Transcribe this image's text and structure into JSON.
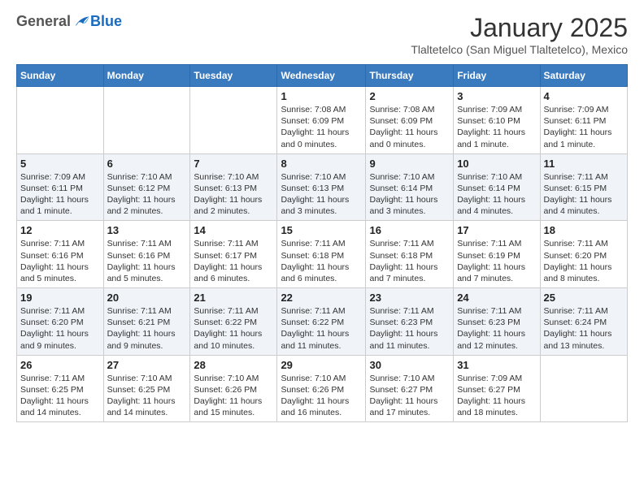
{
  "header": {
    "logo_general": "General",
    "logo_blue": "Blue",
    "month_year": "January 2025",
    "location": "Tlaltetelco (San Miguel Tlaltetelco), Mexico"
  },
  "weekdays": [
    "Sunday",
    "Monday",
    "Tuesday",
    "Wednesday",
    "Thursday",
    "Friday",
    "Saturday"
  ],
  "weeks": [
    [
      {
        "day": "",
        "info": ""
      },
      {
        "day": "",
        "info": ""
      },
      {
        "day": "",
        "info": ""
      },
      {
        "day": "1",
        "info": "Sunrise: 7:08 AM\nSunset: 6:09 PM\nDaylight: 11 hours\nand 0 minutes."
      },
      {
        "day": "2",
        "info": "Sunrise: 7:08 AM\nSunset: 6:09 PM\nDaylight: 11 hours\nand 0 minutes."
      },
      {
        "day": "3",
        "info": "Sunrise: 7:09 AM\nSunset: 6:10 PM\nDaylight: 11 hours\nand 1 minute."
      },
      {
        "day": "4",
        "info": "Sunrise: 7:09 AM\nSunset: 6:11 PM\nDaylight: 11 hours\nand 1 minute."
      }
    ],
    [
      {
        "day": "5",
        "info": "Sunrise: 7:09 AM\nSunset: 6:11 PM\nDaylight: 11 hours\nand 1 minute."
      },
      {
        "day": "6",
        "info": "Sunrise: 7:10 AM\nSunset: 6:12 PM\nDaylight: 11 hours\nand 2 minutes."
      },
      {
        "day": "7",
        "info": "Sunrise: 7:10 AM\nSunset: 6:13 PM\nDaylight: 11 hours\nand 2 minutes."
      },
      {
        "day": "8",
        "info": "Sunrise: 7:10 AM\nSunset: 6:13 PM\nDaylight: 11 hours\nand 3 minutes."
      },
      {
        "day": "9",
        "info": "Sunrise: 7:10 AM\nSunset: 6:14 PM\nDaylight: 11 hours\nand 3 minutes."
      },
      {
        "day": "10",
        "info": "Sunrise: 7:10 AM\nSunset: 6:14 PM\nDaylight: 11 hours\nand 4 minutes."
      },
      {
        "day": "11",
        "info": "Sunrise: 7:11 AM\nSunset: 6:15 PM\nDaylight: 11 hours\nand 4 minutes."
      }
    ],
    [
      {
        "day": "12",
        "info": "Sunrise: 7:11 AM\nSunset: 6:16 PM\nDaylight: 11 hours\nand 5 minutes."
      },
      {
        "day": "13",
        "info": "Sunrise: 7:11 AM\nSunset: 6:16 PM\nDaylight: 11 hours\nand 5 minutes."
      },
      {
        "day": "14",
        "info": "Sunrise: 7:11 AM\nSunset: 6:17 PM\nDaylight: 11 hours\nand 6 minutes."
      },
      {
        "day": "15",
        "info": "Sunrise: 7:11 AM\nSunset: 6:18 PM\nDaylight: 11 hours\nand 6 minutes."
      },
      {
        "day": "16",
        "info": "Sunrise: 7:11 AM\nSunset: 6:18 PM\nDaylight: 11 hours\nand 7 minutes."
      },
      {
        "day": "17",
        "info": "Sunrise: 7:11 AM\nSunset: 6:19 PM\nDaylight: 11 hours\nand 7 minutes."
      },
      {
        "day": "18",
        "info": "Sunrise: 7:11 AM\nSunset: 6:20 PM\nDaylight: 11 hours\nand 8 minutes."
      }
    ],
    [
      {
        "day": "19",
        "info": "Sunrise: 7:11 AM\nSunset: 6:20 PM\nDaylight: 11 hours\nand 9 minutes."
      },
      {
        "day": "20",
        "info": "Sunrise: 7:11 AM\nSunset: 6:21 PM\nDaylight: 11 hours\nand 9 minutes."
      },
      {
        "day": "21",
        "info": "Sunrise: 7:11 AM\nSunset: 6:22 PM\nDaylight: 11 hours\nand 10 minutes."
      },
      {
        "day": "22",
        "info": "Sunrise: 7:11 AM\nSunset: 6:22 PM\nDaylight: 11 hours\nand 11 minutes."
      },
      {
        "day": "23",
        "info": "Sunrise: 7:11 AM\nSunset: 6:23 PM\nDaylight: 11 hours\nand 11 minutes."
      },
      {
        "day": "24",
        "info": "Sunrise: 7:11 AM\nSunset: 6:23 PM\nDaylight: 11 hours\nand 12 minutes."
      },
      {
        "day": "25",
        "info": "Sunrise: 7:11 AM\nSunset: 6:24 PM\nDaylight: 11 hours\nand 13 minutes."
      }
    ],
    [
      {
        "day": "26",
        "info": "Sunrise: 7:11 AM\nSunset: 6:25 PM\nDaylight: 11 hours\nand 14 minutes."
      },
      {
        "day": "27",
        "info": "Sunrise: 7:10 AM\nSunset: 6:25 PM\nDaylight: 11 hours\nand 14 minutes."
      },
      {
        "day": "28",
        "info": "Sunrise: 7:10 AM\nSunset: 6:26 PM\nDaylight: 11 hours\nand 15 minutes."
      },
      {
        "day": "29",
        "info": "Sunrise: 7:10 AM\nSunset: 6:26 PM\nDaylight: 11 hours\nand 16 minutes."
      },
      {
        "day": "30",
        "info": "Sunrise: 7:10 AM\nSunset: 6:27 PM\nDaylight: 11 hours\nand 17 minutes."
      },
      {
        "day": "31",
        "info": "Sunrise: 7:09 AM\nSunset: 6:27 PM\nDaylight: 11 hours\nand 18 minutes."
      },
      {
        "day": "",
        "info": ""
      }
    ]
  ]
}
